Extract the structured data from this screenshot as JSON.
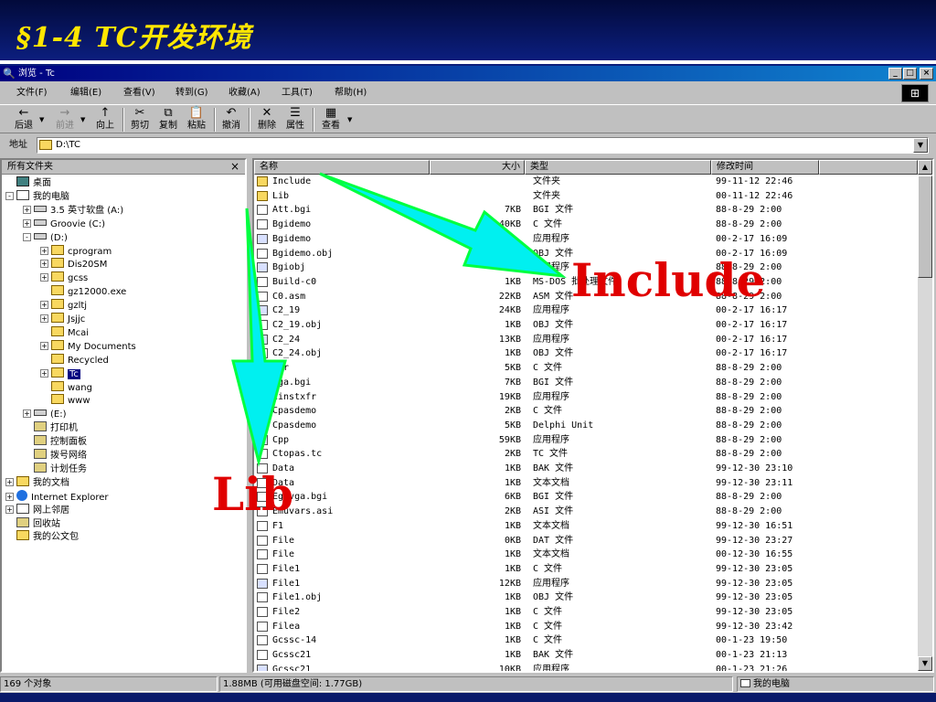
{
  "slide": {
    "title": "§1-4 TC开发环境"
  },
  "window": {
    "title": "浏览 - Tc",
    "controls": [
      "_",
      "□",
      "×"
    ]
  },
  "menu": [
    "文件(F)",
    "编辑(E)",
    "查看(V)",
    "转到(G)",
    "收藏(A)",
    "工具(T)",
    "帮助(H)"
  ],
  "toolbar": [
    {
      "icon": "←",
      "label": "后退",
      "enabled": true
    },
    {
      "icon": "→",
      "label": "前进",
      "enabled": false
    },
    {
      "icon": "↑",
      "label": "向上",
      "enabled": true
    },
    {
      "icon": "✂",
      "label": "剪切",
      "enabled": true
    },
    {
      "icon": "⧉",
      "label": "复制",
      "enabled": true
    },
    {
      "icon": "📋",
      "label": "粘贴",
      "enabled": true
    },
    {
      "icon": "↶",
      "label": "撤消",
      "enabled": true
    },
    {
      "icon": "✕",
      "label": "删除",
      "enabled": true
    },
    {
      "icon": "☰",
      "label": "属性",
      "enabled": true
    },
    {
      "icon": "▦",
      "label": "查看",
      "enabled": true
    }
  ],
  "address": {
    "label": "地址",
    "value": "D:\\TC"
  },
  "tree": {
    "header": "所有文件夹",
    "close": "×",
    "nodes": [
      {
        "label": "桌面",
        "icon": "desk",
        "box": "",
        "depth": 0
      },
      {
        "label": "我的电脑",
        "icon": "pc",
        "box": "-",
        "depth": 0
      },
      {
        "label": "3.5 英寸软盘 (A:)",
        "icon": "drive",
        "box": "+",
        "depth": 1
      },
      {
        "label": "Groovie (C:)",
        "icon": "drive",
        "box": "+",
        "depth": 1
      },
      {
        "label": "(D:)",
        "icon": "drive",
        "box": "-",
        "depth": 1
      },
      {
        "label": "cprogram",
        "icon": "folder",
        "box": "+",
        "depth": 2
      },
      {
        "label": "Dis20SM",
        "icon": "folder",
        "box": "+",
        "depth": 2
      },
      {
        "label": "gcss",
        "icon": "folder",
        "box": "+",
        "depth": 2
      },
      {
        "label": "gz12000.exe",
        "icon": "folder",
        "box": "",
        "depth": 2
      },
      {
        "label": "gzltj",
        "icon": "folder",
        "box": "+",
        "depth": 2
      },
      {
        "label": "Jsjjc",
        "icon": "folder",
        "box": "+",
        "depth": 2
      },
      {
        "label": "Mcai",
        "icon": "folder",
        "box": "",
        "depth": 2
      },
      {
        "label": "My Documents",
        "icon": "folder",
        "box": "+",
        "depth": 2
      },
      {
        "label": "Recycled",
        "icon": "folder",
        "box": "",
        "depth": 2
      },
      {
        "label": "Tc",
        "icon": "folder",
        "box": "+",
        "depth": 2,
        "selected": true
      },
      {
        "label": "wang",
        "icon": "folder",
        "box": "",
        "depth": 2
      },
      {
        "label": "www",
        "icon": "folder",
        "box": "",
        "depth": 2
      },
      {
        "label": "(E:)",
        "icon": "drive",
        "box": "+",
        "depth": 1
      },
      {
        "label": "打印机",
        "icon": "cp",
        "box": "",
        "depth": 1
      },
      {
        "label": "控制面板",
        "icon": "cp",
        "box": "",
        "depth": 1
      },
      {
        "label": "拨号网络",
        "icon": "cp",
        "box": "",
        "depth": 1
      },
      {
        "label": "计划任务",
        "icon": "cp",
        "box": "",
        "depth": 1
      },
      {
        "label": "我的文档",
        "icon": "folder",
        "box": "+",
        "depth": 0
      },
      {
        "label": "Internet Explorer",
        "icon": "ie",
        "box": "+",
        "depth": 0
      },
      {
        "label": "网上邻居",
        "icon": "pc",
        "box": "+",
        "depth": 0
      },
      {
        "label": "回收站",
        "icon": "cp",
        "box": "",
        "depth": 0
      },
      {
        "label": "我的公文包",
        "icon": "folder",
        "box": "",
        "depth": 0
      }
    ]
  },
  "columns": [
    "名称",
    "大小",
    "类型",
    "修改时间"
  ],
  "files": [
    {
      "name": "Include",
      "size": "",
      "type": "文件夹",
      "modified": "99-11-12 22:46",
      "icon": "folder"
    },
    {
      "name": "Lib",
      "size": "",
      "type": "文件夹",
      "modified": "00-11-12 22:46",
      "icon": "folder"
    },
    {
      "name": "Att.bgi",
      "size": "7KB",
      "type": "BGI 文件",
      "modified": "88-8-29 2:00",
      "icon": "file"
    },
    {
      "name": "Bgidemo",
      "size": "40KB",
      "type": "C 文件",
      "modified": "88-8-29 2:00",
      "icon": "file"
    },
    {
      "name": "Bgidemo",
      "size": "",
      "type": "应用程序",
      "modified": "00-2-17 16:09",
      "icon": "app"
    },
    {
      "name": "Bgidemo.obj",
      "size": "",
      "type": "OBJ 文件",
      "modified": "00-2-17 16:09",
      "icon": "file"
    },
    {
      "name": "Bgiobj",
      "size": "12KB",
      "type": "应用程序",
      "modified": "88-8-29 2:00",
      "icon": "app"
    },
    {
      "name": "Build-c0",
      "size": "1KB",
      "type": "MS-DOS 批处理文件",
      "modified": "88-8-29 2:00",
      "icon": "file"
    },
    {
      "name": "C0.asm",
      "size": "22KB",
      "type": "ASM 文件",
      "modified": "88-8-29 2:00",
      "icon": "file"
    },
    {
      "name": "C2_19",
      "size": "24KB",
      "type": "应用程序",
      "modified": "00-2-17 16:17",
      "icon": "app"
    },
    {
      "name": "C2_19.obj",
      "size": "1KB",
      "type": "OBJ 文件",
      "modified": "00-2-17 16:17",
      "icon": "file"
    },
    {
      "name": "C2_24",
      "size": "13KB",
      "type": "应用程序",
      "modified": "00-2-17 16:17",
      "icon": "app"
    },
    {
      "name": "C2_24.obj",
      "size": "1KB",
      "type": "OBJ 文件",
      "modified": "00-2-17 16:17",
      "icon": "file"
    },
    {
      "name": "Car",
      "size": "5KB",
      "type": "C 文件",
      "modified": "88-8-29 2:00",
      "icon": "file"
    },
    {
      "name": "Cga.bgi",
      "size": "7KB",
      "type": "BGI 文件",
      "modified": "88-8-29 2:00",
      "icon": "file"
    },
    {
      "name": "Cinstxfr",
      "size": "19KB",
      "type": "应用程序",
      "modified": "88-8-29 2:00",
      "icon": "app"
    },
    {
      "name": "Cpasdemo",
      "size": "2KB",
      "type": "C 文件",
      "modified": "88-8-29 2:00",
      "icon": "file"
    },
    {
      "name": "Cpasdemo",
      "size": "5KB",
      "type": "Delphi Unit",
      "modified": "88-8-29 2:00",
      "icon": "file"
    },
    {
      "name": "Cpp",
      "size": "59KB",
      "type": "应用程序",
      "modified": "88-8-29 2:00",
      "icon": "app"
    },
    {
      "name": "Ctopas.tc",
      "size": "2KB",
      "type": "TC 文件",
      "modified": "88-8-29 2:00",
      "icon": "file"
    },
    {
      "name": "Data",
      "size": "1KB",
      "type": "BAK 文件",
      "modified": "99-12-30 23:10",
      "icon": "file"
    },
    {
      "name": "Data",
      "size": "1KB",
      "type": "文本文档",
      "modified": "99-12-30 23:11",
      "icon": "file"
    },
    {
      "name": "Egavga.bgi",
      "size": "6KB",
      "type": "BGI 文件",
      "modified": "88-8-29 2:00",
      "icon": "file"
    },
    {
      "name": "Emuvars.asi",
      "size": "2KB",
      "type": "ASI 文件",
      "modified": "88-8-29 2:00",
      "icon": "file"
    },
    {
      "name": "F1",
      "size": "1KB",
      "type": "文本文档",
      "modified": "99-12-30 16:51",
      "icon": "file"
    },
    {
      "name": "File",
      "size": "0KB",
      "type": "DAT 文件",
      "modified": "99-12-30 23:27",
      "icon": "file"
    },
    {
      "name": "File",
      "size": "1KB",
      "type": "文本文档",
      "modified": "00-12-30 16:55",
      "icon": "file"
    },
    {
      "name": "File1",
      "size": "1KB",
      "type": "C 文件",
      "modified": "99-12-30 23:05",
      "icon": "file"
    },
    {
      "name": "File1",
      "size": "12KB",
      "type": "应用程序",
      "modified": "99-12-30 23:05",
      "icon": "app"
    },
    {
      "name": "File1.obj",
      "size": "1KB",
      "type": "OBJ 文件",
      "modified": "99-12-30 23:05",
      "icon": "file"
    },
    {
      "name": "File2",
      "size": "1KB",
      "type": "C 文件",
      "modified": "99-12-30 23:05",
      "icon": "file"
    },
    {
      "name": "Filea",
      "size": "1KB",
      "type": "C 文件",
      "modified": "99-12-30 23:42",
      "icon": "file"
    },
    {
      "name": "Gcssc-14",
      "size": "1KB",
      "type": "C 文件",
      "modified": "00-1-23 19:50",
      "icon": "file"
    },
    {
      "name": "Gcssc21",
      "size": "1KB",
      "type": "BAK 文件",
      "modified": "00-1-23 21:13",
      "icon": "file"
    },
    {
      "name": "Gcssc21",
      "size": "10KB",
      "type": "应用程序",
      "modified": "00-1-23 21:26",
      "icon": "app"
    }
  ],
  "status": {
    "count": "169 个对象",
    "space": "1.88MB (可用磁盘空间: 1.77GB)",
    "location": "我的电脑"
  },
  "annotations": {
    "include": "Include",
    "lib": "Lib",
    "arrow_color": "#00f0f0",
    "arrow_outline": "#00ff40",
    "text_color": "#e00000"
  }
}
